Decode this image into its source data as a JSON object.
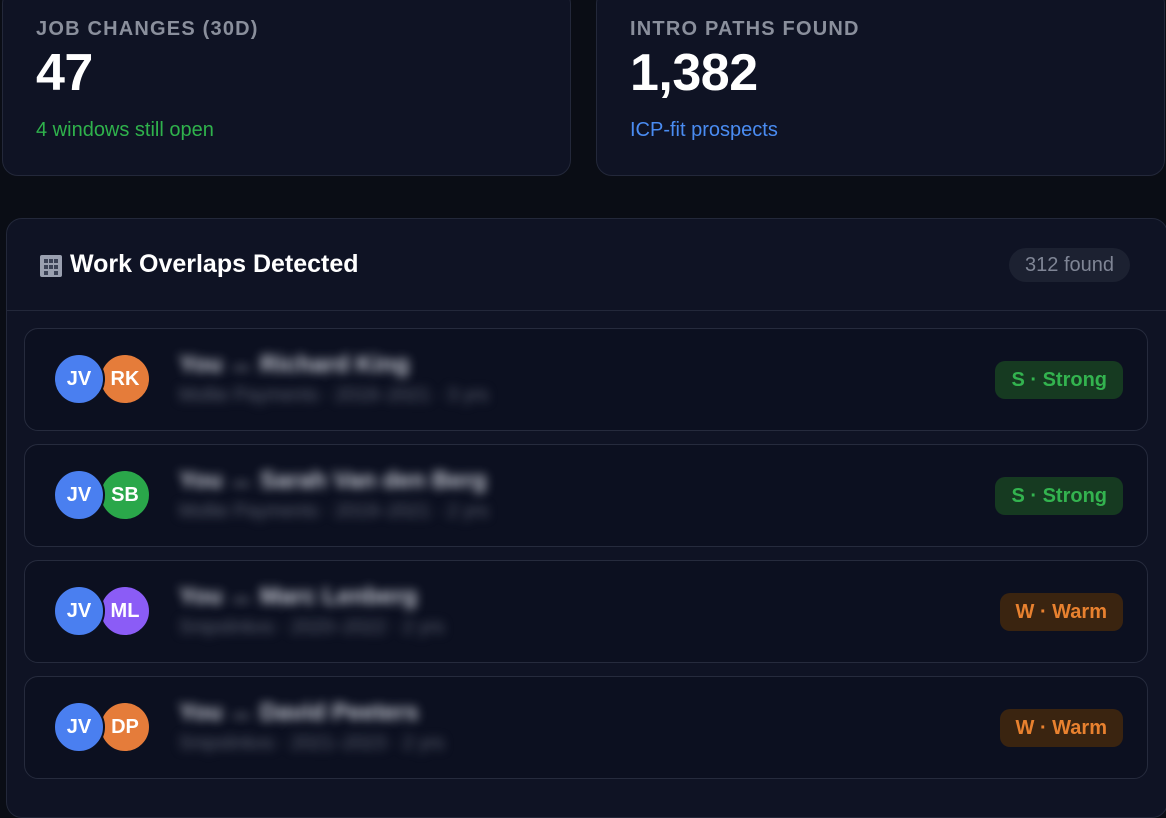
{
  "stats": [
    {
      "label": "JOB CHANGES (30D)",
      "value": "47",
      "sub": "4 windows still open",
      "sub_color": "#2fb24c"
    },
    {
      "label": "INTRO PATHS FOUND",
      "value": "1,382",
      "sub": "ICP-fit prospects",
      "sub_color": "#4a8cf2"
    }
  ],
  "panel": {
    "icon": "building-icon",
    "title": "Work Overlaps Detected",
    "count": "312 found",
    "rows": [
      {
        "avatar1": {
          "initials": "JV",
          "color": "#4a7ff0"
        },
        "avatar2": {
          "initials": "RK",
          "color": "#e57c3a"
        },
        "name": "You ↔ Richard King",
        "meta": "Mollie Payments · 2018–2021 · 3 yrs",
        "strength": "S · Strong",
        "tier": "strong"
      },
      {
        "avatar1": {
          "initials": "JV",
          "color": "#4a7ff0"
        },
        "avatar2": {
          "initials": "SB",
          "color": "#2aa74a"
        },
        "name": "You ↔ Sarah Van den Berg",
        "meta": "Mollie Payments · 2019–2021 · 2 yrs",
        "strength": "S · Strong",
        "tier": "strong"
      },
      {
        "avatar1": {
          "initials": "JV",
          "color": "#4a7ff0"
        },
        "avatar2": {
          "initials": "ML",
          "color": "#8b5cf6"
        },
        "name": "You ↔ Marc Lenberg",
        "meta": "Snipslinkxs · 2020–2022 · 2 yrs",
        "strength": "W · Warm",
        "tier": "warm"
      },
      {
        "avatar1": {
          "initials": "JV",
          "color": "#4a7ff0"
        },
        "avatar2": {
          "initials": "DP",
          "color": "#e57c3a"
        },
        "name": "You ↔ David Peeters",
        "meta": "Snipslinkxs · 2021–2023 · 2 yrs",
        "strength": "W · Warm",
        "tier": "warm"
      }
    ]
  }
}
